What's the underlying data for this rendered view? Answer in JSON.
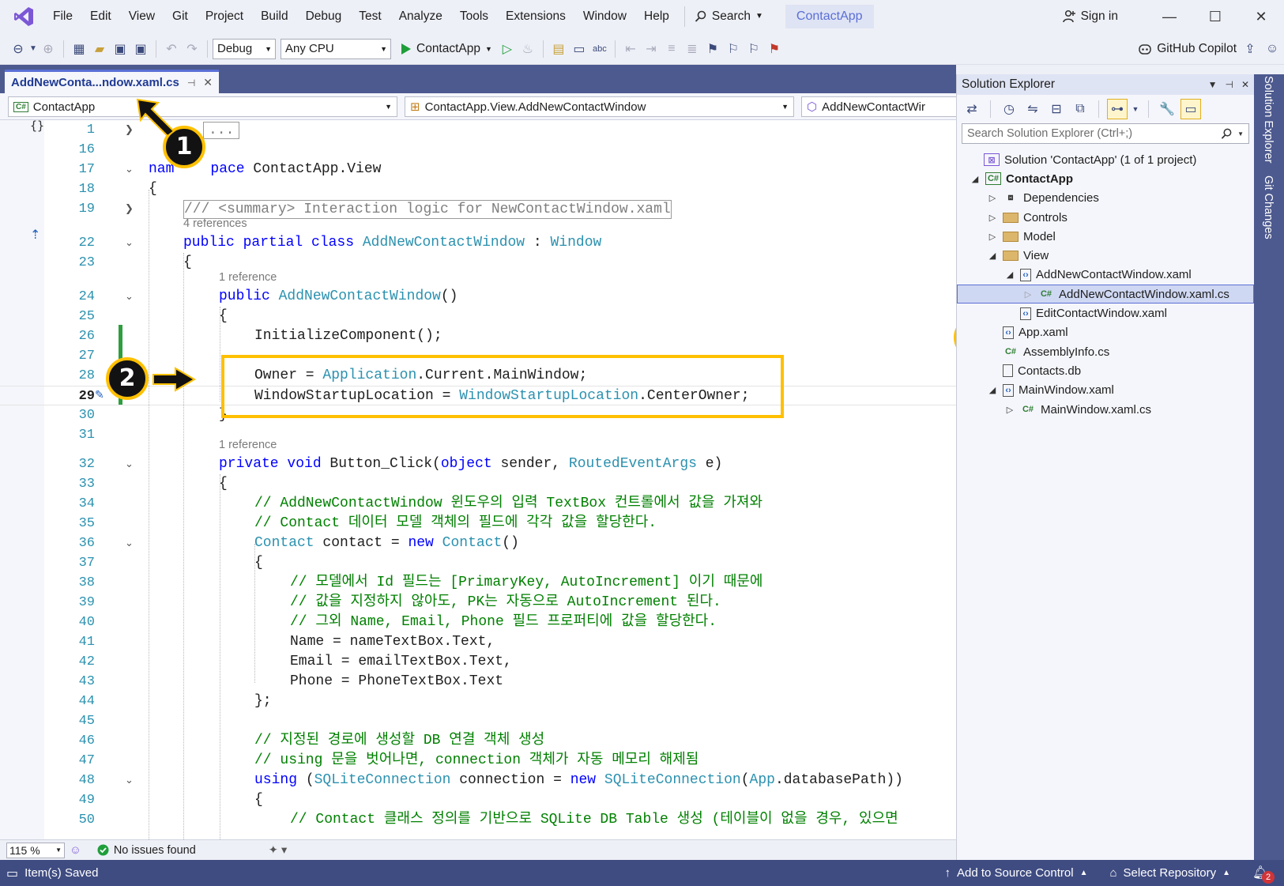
{
  "menu": [
    "File",
    "Edit",
    "View",
    "Git",
    "Project",
    "Build",
    "Debug",
    "Test",
    "Analyze",
    "Tools",
    "Extensions",
    "Window",
    "Help"
  ],
  "title_search": "Search",
  "app_title": "ContactApp",
  "sign_in": "Sign in",
  "toolbar": {
    "config": "Debug",
    "platform": "Any CPU",
    "run_target": "ContactApp",
    "copilot": "GitHub Copilot"
  },
  "doc_tab": "AddNewConta...ndow.xaml.cs",
  "nav": {
    "project": "ContactApp",
    "class": "ContactApp.View.AddNewContactWindow",
    "member": "AddNewContactWir"
  },
  "editor": {
    "fold_placeholder": "...",
    "summary_comment": "/// <summary> Interaction logic for NewContactWindow.xaml",
    "lens_4": "4 references",
    "lens_1a": "1 reference",
    "lens_1b": "1 reference",
    "lines": {
      "l17a": "nam",
      "l17b": "pace",
      "l17c": " ContactApp.View",
      "l18": "{",
      "l22a": "public partial class",
      "l22b": "AddNewContactWindow",
      "l22c": " : ",
      "l22d": "Window",
      "l23": "{",
      "l24a": "public",
      "l24b": "AddNewContactWindow",
      "l24c": "()",
      "l25": "{",
      "l26": "InitializeComponent();",
      "l28a": "Owner = ",
      "l28b": "Application",
      "l28c": ".Current.MainWindow;",
      "l29a": "WindowStartupLocation = ",
      "l29b": "WindowStartupLocation",
      "l29c": ".CenterOwner;",
      "l30": "}",
      "l32a": "private void",
      "l32b": " Button_Click(",
      "l32c": "object",
      "l32d": " sender, ",
      "l32e": "RoutedEventArgs",
      "l32f": " e)",
      "l33": "{",
      "l34": "// AddNewContactWindow 윈도우의 입력 TextBox 컨트롤에서 값을 가져와",
      "l35": "// Contact 데이터 모델 객체의 필드에 각각 값을 할당한다.",
      "l36a": "Contact",
      "l36b": " contact = ",
      "l36c": "new",
      "l36d": " ",
      "l36e": "Contact",
      "l36f": "()",
      "l37": "{",
      "l38": "// 모델에서 Id 필드는 [PrimaryKey, AutoIncrement] 이기 때문에",
      "l39": "// 값을 지정하지 않아도, PK는 자동으로 AutoIncrement 된다.",
      "l40": "// 그외 Name, Email, Phone 필드 프로퍼티에 값을 할당한다.",
      "l41": "Name = nameTextBox.Text,",
      "l42": "Email = emailTextBox.Text,",
      "l43": "Phone = PhoneTextBox.Text",
      "l44": "};",
      "l46": "// 지정된 경로에 생성할 DB 연결 객체 생성",
      "l47": "// using 문을 벗어나면, connection 객체가 자동 메모리 해제됨",
      "l48a": "using",
      "l48b": " (",
      "l48c": "SQLiteConnection",
      "l48d": " connection = ",
      "l48e": "new",
      "l48f": " ",
      "l48g": "SQLiteConnection",
      "l48h": "(",
      "l48i": "App",
      "l48j": ".databasePath))",
      "l49": "{",
      "l50": "// Contact 클래스 정의를 기반으로 SQLite DB Table 생성 (테이블이 없을 경우, 있으면"
    },
    "line_numbers": [
      "1",
      "16",
      "17",
      "18",
      "19",
      "22",
      "23",
      "24",
      "25",
      "26",
      "27",
      "28",
      "29",
      "30",
      "31",
      "32",
      "33",
      "34",
      "35",
      "36",
      "37",
      "38",
      "39",
      "40",
      "41",
      "42",
      "43",
      "44",
      "45",
      "46",
      "47",
      "48",
      "49",
      "50"
    ]
  },
  "editor_status": {
    "zoom": "115 %",
    "issues": "No issues found"
  },
  "solution_explorer": {
    "title": "Solution Explorer",
    "search_placeholder": "Search Solution Explorer (Ctrl+;)",
    "items": [
      {
        "label": "Solution 'ContactApp' (1 of 1 project)"
      },
      {
        "label": "ContactApp"
      },
      {
        "label": "Dependencies"
      },
      {
        "label": "Controls"
      },
      {
        "label": "Model"
      },
      {
        "label": "View"
      },
      {
        "label": "AddNewContactWindow.xaml"
      },
      {
        "label": "AddNewContactWindow.xaml.cs"
      },
      {
        "label": "EditContactWindow.xaml"
      },
      {
        "label": "App.xaml"
      },
      {
        "label": "AssemblyInfo.cs"
      },
      {
        "label": "Contacts.db"
      },
      {
        "label": "MainWindow.xaml"
      },
      {
        "label": "MainWindow.xaml.cs"
      }
    ]
  },
  "side_tabs": [
    "Solution Explorer",
    "Git Changes"
  ],
  "statusbar": {
    "saved": "Item(s) Saved",
    "source_control": "Add to Source Control",
    "repository": "Select Repository",
    "notifications": "2"
  },
  "annotations": {
    "badge_1": "1",
    "badge_2": "2"
  },
  "colors": {
    "accent": "#5b6fd6",
    "annotation": "#ffc000",
    "keyword": "#0000ff",
    "type": "#2b91af",
    "comment": "#008000"
  }
}
